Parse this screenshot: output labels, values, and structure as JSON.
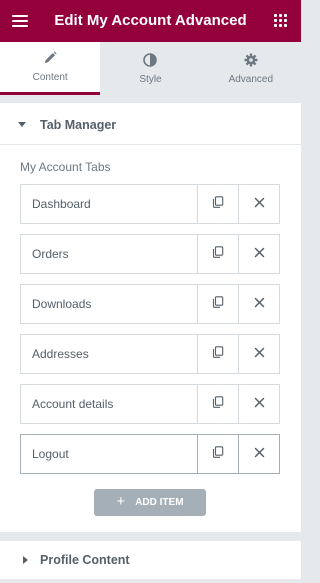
{
  "header": {
    "title": "Edit My Account Advanced",
    "menu_icon": "hamburger-icon",
    "apps_icon": "grid-icon"
  },
  "tabs": [
    {
      "label": "Content",
      "icon": "pencil-icon",
      "active": true
    },
    {
      "label": "Style",
      "icon": "half-circle-icon",
      "active": false
    },
    {
      "label": "Advanced",
      "icon": "gear-icon",
      "active": false
    }
  ],
  "section": {
    "title": "Tab Manager",
    "expanded": true
  },
  "control": {
    "label": "My Account Tabs"
  },
  "items": [
    {
      "title": "Dashboard"
    },
    {
      "title": "Orders"
    },
    {
      "title": "Downloads"
    },
    {
      "title": "Addresses"
    },
    {
      "title": "Account details"
    },
    {
      "title": "Logout"
    }
  ],
  "add_button": {
    "label": "ADD ITEM"
  },
  "section2": {
    "title": "Profile Content",
    "expanded": false
  },
  "colors": {
    "brand": "#93003c",
    "button": "#a4afb7"
  }
}
